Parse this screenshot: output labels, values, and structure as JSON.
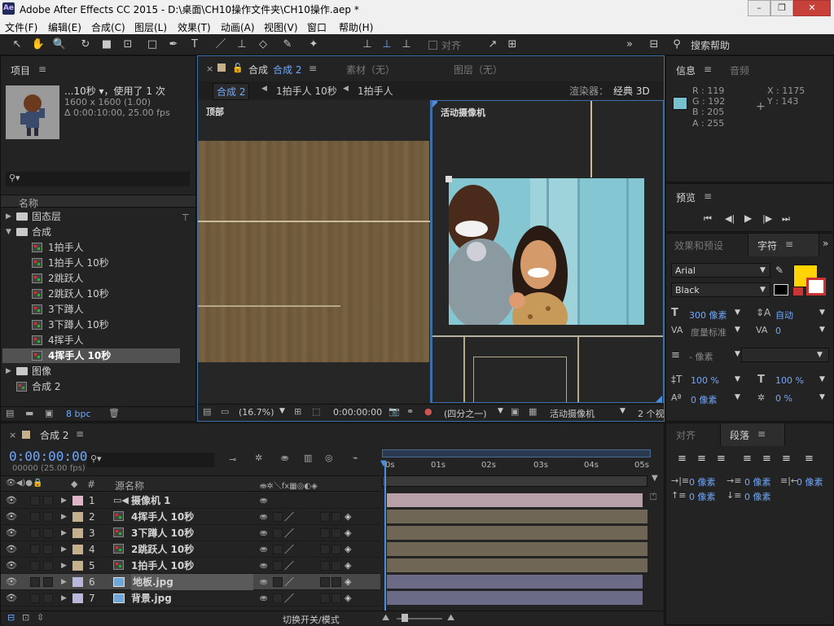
{
  "titlebar": {
    "app_icon": "Ae",
    "title": "Adobe After Effects CC 2015 - D:\\桌面\\CH10操作文件夹\\CH10操作.aep *",
    "minimize": "–",
    "restore": "❐",
    "close": "✕"
  },
  "menu": [
    "文件(F)",
    "编辑(E)",
    "合成(C)",
    "图层(L)",
    "效果(T)",
    "动画(A)",
    "视图(V)",
    "窗口",
    "帮助(H)"
  ],
  "toolbar": {
    "align_label": "对齐",
    "search_help": "搜索帮助"
  },
  "project": {
    "tab": "项目",
    "item_name": "...10秒 ▾，使用了 1 次",
    "item_size": "1600 x 1600 (1.00)",
    "item_duration": "Δ 0:00:10:00, 25.00 fps",
    "column_name": "名称",
    "items": [
      {
        "type": "folder",
        "label": "固态层"
      },
      {
        "type": "folder-open",
        "label": "合成"
      },
      {
        "type": "comp",
        "label": "1拍手人"
      },
      {
        "type": "comp",
        "label": "1拍手人 10秒"
      },
      {
        "type": "comp",
        "label": "2跳跃人"
      },
      {
        "type": "comp",
        "label": "2跳跃人 10秒"
      },
      {
        "type": "comp",
        "label": "3下蹲人"
      },
      {
        "type": "comp",
        "label": "3下蹲人 10秒"
      },
      {
        "type": "comp",
        "label": "4挥手人"
      },
      {
        "type": "comp",
        "label": "4挥手人 10秒",
        "selected": true
      },
      {
        "type": "folder",
        "label": "图像"
      },
      {
        "type": "comp",
        "label": "合成 2"
      }
    ],
    "bpc": "8 bpc"
  },
  "viewer": {
    "tab_prefix": "合成",
    "tab_active": "合成 2",
    "tab_footage": "素材（无）",
    "tab_layer": "图层（无）",
    "breadcrumb": [
      "合成 2",
      "1拍手人 10秒",
      "1拍手人"
    ],
    "renderer_label": "渲染器：",
    "renderer_value": "经典 3D",
    "view_left": "顶部",
    "view_right": "活动摄像机",
    "zoom": "(16.7%)",
    "timecode": "0:00:00:00",
    "resolution": "(四分之一)",
    "camera": "活动摄像机",
    "views": "2 个视"
  },
  "info": {
    "tab": "信息",
    "tab2": "音频",
    "r": "R : 119",
    "g": "G : 192",
    "b": "B : 205",
    "a": "A : 255",
    "x": "X : 1175",
    "y": "Y : 143",
    "swatch_color": "#77c0cd"
  },
  "preview": {
    "tab": "预览"
  },
  "character": {
    "tab_effects": "效果和预设",
    "tab": "字符",
    "font": "Arial",
    "style": "Black",
    "size": "300 像素",
    "leading": "自动",
    "kerning": "度量标准",
    "tracking": "0",
    "stroke": "- 像素",
    "vscale": "100 %",
    "hscale": "100 %",
    "baseline": "0 像素",
    "tsume": "0 %",
    "fill_color": "#ffd400"
  },
  "paragraph": {
    "tab_align": "对齐",
    "tab": "段落",
    "indent_left": "0 像素",
    "indent_first": "0 像素",
    "indent_right": "0 像素",
    "space_before": "0 像素",
    "space_after": "0 像素"
  },
  "timeline": {
    "tab": "合成 2",
    "timecode": "0:00:00:00",
    "fps": "00000 (25.00 fps)",
    "col_num": "#",
    "col_name": "源名称",
    "ruler": [
      "0s",
      "01s",
      "02s",
      "03s",
      "04s",
      "05s"
    ],
    "layers": [
      {
        "num": "1",
        "name": "摄像机 1",
        "color": "#e0b3c8",
        "bar": "#b8a0a8",
        "camera": true
      },
      {
        "num": "2",
        "name": "4挥手人 10秒",
        "color": "#c4b08a",
        "bar": "#6f6655"
      },
      {
        "num": "3",
        "name": "3下蹲人 10秒",
        "color": "#c4b08a",
        "bar": "#6f6655"
      },
      {
        "num": "4",
        "name": "2跳跃人 10秒",
        "color": "#c4b08a",
        "bar": "#6f6655"
      },
      {
        "num": "5",
        "name": "1拍手人 10秒",
        "color": "#c4b08a",
        "bar": "#6f6655"
      },
      {
        "num": "6",
        "name": "地板.jpg",
        "color": "#b8b8dc",
        "bar": "#6b6b88",
        "selected": true,
        "image": true
      },
      {
        "num": "7",
        "name": "背景.jpg",
        "color": "#b8b8dc",
        "bar": "#6b6b88",
        "image": true
      }
    ],
    "toggle_label": "切换开关/模式"
  }
}
